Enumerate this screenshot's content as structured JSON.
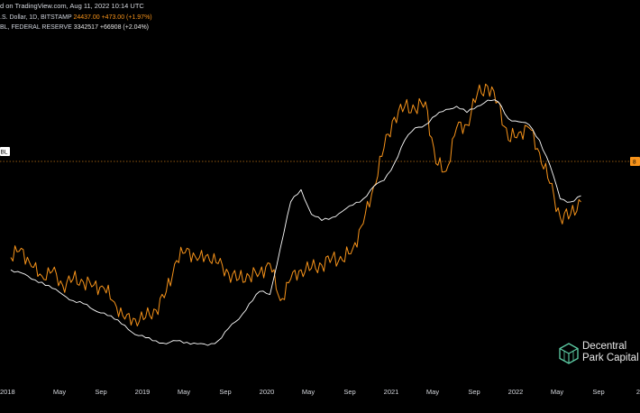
{
  "header": {
    "published": "d on TradingView.com, Aug 11, 2022 10:14 UTC"
  },
  "legend": {
    "series1_name": ".S. Dollar, 1D, BITSTAMP",
    "series1_values": "24437.00  +473.00 (+1.97%)",
    "series2_name": "BL, FEDERAL RESERVE",
    "series2_values": "3342517  +66908 (+2.04%)"
  },
  "left_tag": "BL",
  "right_tag": "8",
  "watermark": {
    "line1": "Decentral",
    "line2": "Park Capital"
  },
  "colors": {
    "btc": "#f7931a",
    "liquidity": "#ffffff",
    "background": "#000000",
    "axis_text": "#d5d7dd",
    "dotted_line": "#f7931a"
  },
  "chart_data": {
    "type": "line",
    "xaxis": {
      "ticks": [
        "2018",
        "May",
        "Sep",
        "2019",
        "May",
        "Sep",
        "2020",
        "May",
        "Sep",
        "2021",
        "May",
        "Sep",
        "2022",
        "May",
        "Sep",
        "20"
      ]
    },
    "series": [
      {
        "name": ".S. Dollar, 1D, BITSTAMP",
        "color": "#f7931a",
        "x": [
          "2018-01",
          "2018-02",
          "2018-03",
          "2018-04",
          "2018-05",
          "2018-06",
          "2018-07",
          "2018-08",
          "2018-09",
          "2018-10",
          "2018-11",
          "2018-12",
          "2019-01",
          "2019-02",
          "2019-03",
          "2019-04",
          "2019-05",
          "2019-06",
          "2019-07",
          "2019-08",
          "2019-09",
          "2019-10",
          "2019-11",
          "2019-12",
          "2020-01",
          "2020-02",
          "2020-03",
          "2020-04",
          "2020-05",
          "2020-06",
          "2020-07",
          "2020-08",
          "2020-09",
          "2020-10",
          "2020-11",
          "2020-12",
          "2021-01",
          "2021-02",
          "2021-03",
          "2021-04",
          "2021-05",
          "2021-06",
          "2021-07",
          "2021-08",
          "2021-09",
          "2021-10",
          "2021-11",
          "2021-12",
          "2022-01",
          "2022-02",
          "2022-03",
          "2022-04",
          "2022-05",
          "2022-06",
          "2022-07",
          "2022-08"
        ],
        "values": [
          64,
          70,
          58,
          52,
          55,
          46,
          50,
          48,
          46,
          44,
          35,
          24,
          24,
          25,
          30,
          42,
          62,
          70,
          62,
          66,
          60,
          54,
          50,
          52,
          54,
          60,
          36,
          50,
          56,
          57,
          59,
          64,
          62,
          70,
          86,
          110,
          135,
          155,
          162,
          160,
          165,
          125,
          120,
          148,
          150,
          170,
          175,
          165,
          140,
          145,
          148,
          132,
          112,
          90,
          92,
          100
        ]
      },
      {
        "name": "BL, FEDERAL RESERVE",
        "color": "#ffffff",
        "x": [
          "2018-01",
          "2018-02",
          "2018-03",
          "2018-04",
          "2018-05",
          "2018-06",
          "2018-07",
          "2018-08",
          "2018-09",
          "2018-10",
          "2018-11",
          "2018-12",
          "2019-01",
          "2019-02",
          "2019-03",
          "2019-04",
          "2019-05",
          "2019-06",
          "2019-07",
          "2019-08",
          "2019-09",
          "2019-10",
          "2019-11",
          "2019-12",
          "2020-01",
          "2020-02",
          "2020-03",
          "2020-04",
          "2020-05",
          "2020-06",
          "2020-07",
          "2020-08",
          "2020-09",
          "2020-10",
          "2020-11",
          "2020-12",
          "2021-01",
          "2021-02",
          "2021-03",
          "2021-04",
          "2021-05",
          "2021-06",
          "2021-07",
          "2021-08",
          "2021-09",
          "2021-10",
          "2021-11",
          "2021-12",
          "2022-01",
          "2022-02",
          "2022-03",
          "2022-04",
          "2022-05",
          "2022-06",
          "2022-07",
          "2022-08"
        ],
        "values": [
          56,
          54,
          50,
          48,
          44,
          40,
          36,
          34,
          30,
          28,
          24,
          20,
          14,
          12,
          10,
          8,
          10,
          9,
          8,
          7,
          10,
          18,
          24,
          34,
          42,
          40,
          70,
          100,
          108,
          92,
          88,
          90,
          94,
          98,
          102,
          110,
          114,
          125,
          140,
          148,
          150,
          156,
          160,
          162,
          158,
          162,
          166,
          165,
          154,
          152,
          150,
          140,
          124,
          102,
          100,
          104
        ]
      }
    ]
  }
}
